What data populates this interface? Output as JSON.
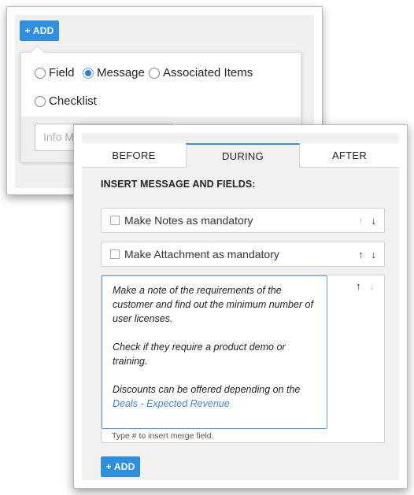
{
  "back_panel": {
    "add_button_label": "+ ADD",
    "options": [
      {
        "label": "Field",
        "selected": false
      },
      {
        "label": "Message",
        "selected": true
      },
      {
        "label": "Associated Items",
        "selected": false
      },
      {
        "label": "Checklist",
        "selected": false
      }
    ],
    "info_input_value": "Info Me"
  },
  "front_panel": {
    "tabs": [
      {
        "label": "BEFORE",
        "active": false
      },
      {
        "label": "DURING",
        "active": true
      },
      {
        "label": "AFTER",
        "active": false
      }
    ],
    "section_title": "INSERT MESSAGE AND FIELDS:",
    "rows": [
      {
        "label": "Make Notes as mandatory",
        "checked": false
      },
      {
        "label": "Make Attachment as mandatory",
        "checked": false
      }
    ],
    "message": {
      "lines": [
        "Make a note of the requirements of the",
        "customer and find out the minimum number of",
        "user licenses.",
        "Check if they require a product demo or",
        "training.",
        "Discounts can be offered depending on the"
      ],
      "merge_field": "Deals - Expected Revenue",
      "hint": "Type # to insert merge field."
    },
    "add_button_label": "+ ADD"
  },
  "icons": {
    "up": "↑",
    "down": "↓"
  },
  "colors": {
    "accent": "#2e8ee0",
    "tab_active_border": "#3a8fd8",
    "link": "#3a87d6"
  }
}
